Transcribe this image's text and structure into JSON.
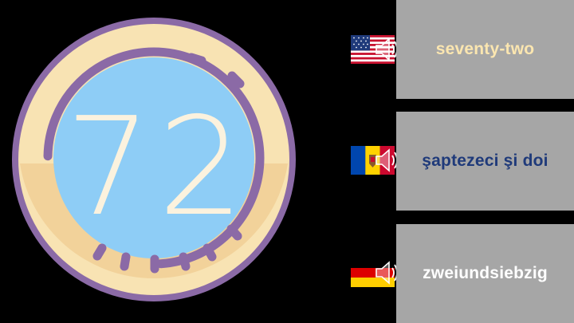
{
  "badge": {
    "number": "72"
  },
  "rows": [
    {
      "language": "English (US)",
      "flag_icon": "us-flag-icon",
      "audio_icon": "speaker-icon",
      "word": "seventy-two",
      "word_color": "#fbe6b0"
    },
    {
      "language": "Romanian (Moldova)",
      "flag_icon": "moldova-flag-icon",
      "audio_icon": "speaker-icon",
      "word": "şaptezeci şi doi",
      "word_color": "#1f3a7a"
    },
    {
      "language": "German",
      "flag_icon": "germany-flag-icon",
      "audio_icon": "speaker-icon",
      "word": "zweiundsiebzig",
      "word_color": "#ffffff"
    }
  ],
  "colors": {
    "background": "#000000",
    "ring": "#8b6aa6",
    "cream": "#f8e3b3",
    "sky": "#8ecdf6",
    "panel": "#a6a6a6"
  }
}
